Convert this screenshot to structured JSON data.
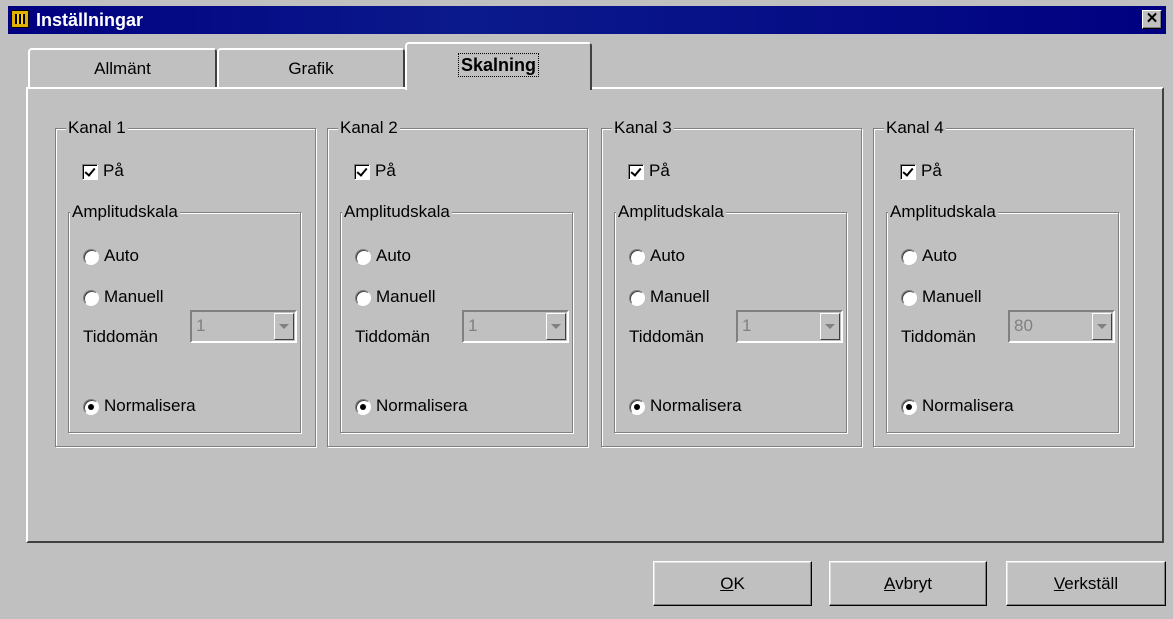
{
  "window": {
    "title": "Inställningar",
    "close_glyph": "✕"
  },
  "tabs": [
    {
      "label": "Allmänt",
      "selected": false
    },
    {
      "label": "Grafik",
      "selected": false
    },
    {
      "label": "Skalning",
      "selected": true
    }
  ],
  "channels": [
    {
      "title": "Kanal 1",
      "on_label": "På",
      "on_checked": true,
      "group_title": "Amplitudskala",
      "auto_label": "Auto",
      "manual_label": "Manuell",
      "time_label": "Tiddomän",
      "time_value": "1",
      "normalize_label": "Normalisera",
      "selected_mode": "Normalisera"
    },
    {
      "title": "Kanal 2",
      "on_label": "På",
      "on_checked": true,
      "group_title": "Amplitudskala",
      "auto_label": "Auto",
      "manual_label": "Manuell",
      "time_label": "Tiddomän",
      "time_value": "1",
      "normalize_label": "Normalisera",
      "selected_mode": "Normalisera"
    },
    {
      "title": "Kanal 3",
      "on_label": "På",
      "on_checked": true,
      "group_title": "Amplitudskala",
      "auto_label": "Auto",
      "manual_label": "Manuell",
      "time_label": "Tiddomän",
      "time_value": "1",
      "normalize_label": "Normalisera",
      "selected_mode": "Normalisera"
    },
    {
      "title": "Kanal 4",
      "on_label": "På",
      "on_checked": true,
      "group_title": "Amplitudskala",
      "auto_label": "Auto",
      "manual_label": "Manuell",
      "time_label": "Tiddomän",
      "time_value": "80",
      "normalize_label": "Normalisera",
      "selected_mode": "Normalisera"
    }
  ],
  "buttons": {
    "ok": {
      "mnemonic": "O",
      "rest": "K"
    },
    "cancel": {
      "mnemonic": "A",
      "rest": "vbryt"
    },
    "apply": {
      "mnemonic": "V",
      "rest": "erkställ"
    }
  },
  "colors": {
    "face": "#c0c0c0",
    "titlebar": "#000080",
    "disabled_text": "#808080"
  }
}
